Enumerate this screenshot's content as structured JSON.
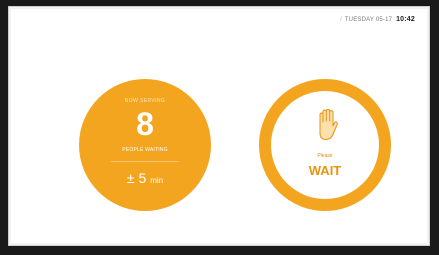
{
  "status_bar": {
    "day": "TUESDAY",
    "date": "05-17",
    "time": "10:42"
  },
  "queue": {
    "top_label": "NOW SERVING",
    "people_waiting": "8",
    "people_label": "PEOPLE WAITING",
    "wait_prefix": "± ",
    "wait_value": "5",
    "wait_unit": "min"
  },
  "status": {
    "icon": "hand-stop-icon",
    "prompt": "Please",
    "message": "WAIT"
  },
  "colors": {
    "accent": "#f3a51f",
    "accent_text": "#e8940f",
    "background": "#ffffff",
    "frame": "#1a1a1a"
  }
}
